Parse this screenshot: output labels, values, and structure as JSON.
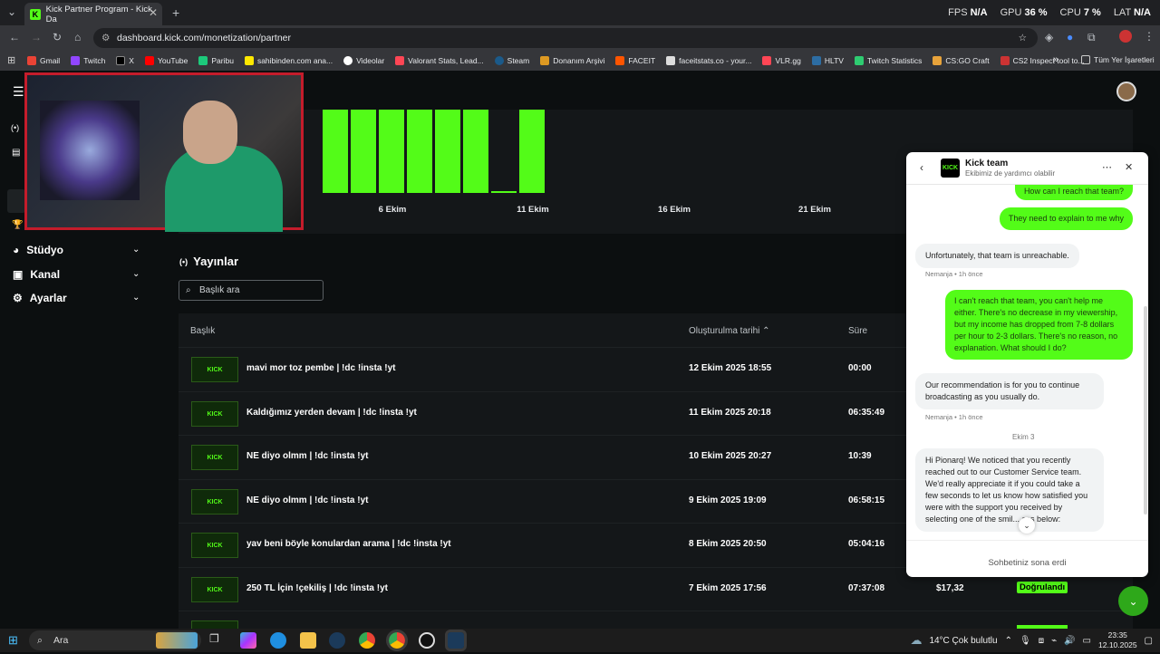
{
  "browser": {
    "tab_title": "Kick Partner Program - Kick Da",
    "tab_favicon": "K",
    "new_tab": "+",
    "url": "dashboard.kick.com/monetization/partner",
    "perf": [
      {
        "label": "FPS",
        "value": "N/A"
      },
      {
        "label": "GPU",
        "value": "36 %"
      },
      {
        "label": "CPU",
        "value": "7 %"
      },
      {
        "label": "LAT",
        "value": "N/A"
      }
    ],
    "bookmarks": [
      "Gmail",
      "Twitch",
      "X",
      "YouTube",
      "Paribu",
      "sahibinden.com ana...",
      "Videolar",
      "Valorant Stats, Lead...",
      "Steam",
      "Donanım Arşivi",
      "FACEIT",
      "faceitstats.co - your...",
      "VLR.gg",
      "HLTV",
      "Twitch Statistics",
      "CS:GO Craft",
      "CS2 Inspect tool to..."
    ],
    "bookmarks_more": "»",
    "all_bookmarks": "Tüm Yer İşaretleri"
  },
  "sidebar": {
    "items": [
      {
        "label": "Stüdyo"
      },
      {
        "label": "Kanal"
      },
      {
        "label": "Ayarlar"
      }
    ]
  },
  "chart_data": {
    "type": "bar",
    "tick_labels": [
      "6 Ekim",
      "11 Ekim",
      "16 Ekim",
      "21 Ekim"
    ],
    "bar_color": "#53fc18"
  },
  "streams": {
    "heading": "Yayınlar",
    "search_placeholder": "Başlık ara",
    "col_title": "Başlık",
    "col_created": "Oluşturulma tarihi",
    "col_duration": "Süre",
    "rows": [
      {
        "title": "mavi mor toz pembe | !dc !insta !yt",
        "date": "12 Ekim 2025 18:55",
        "duration": "00:00",
        "revenue": "",
        "status": ""
      },
      {
        "title": "Kaldığımız yerden devam | !dc !insta !yt",
        "date": "11 Ekim 2025 20:18",
        "duration": "06:35:49",
        "revenue": "",
        "status": ""
      },
      {
        "title": "NE diyo olmm | !dc !insta !yt",
        "date": "10 Ekim 2025 20:27",
        "duration": "10:39",
        "revenue": "",
        "status": ""
      },
      {
        "title": "NE diyo olmm | !dc !insta !yt",
        "date": "9 Ekim 2025 19:09",
        "duration": "06:58:15",
        "revenue": "",
        "status": ""
      },
      {
        "title": "yav beni böyle konulardan arama | !dc !insta !yt",
        "date": "8 Ekim 2025 20:50",
        "duration": "05:04:16",
        "revenue": "",
        "status": ""
      },
      {
        "title": "250 TL İçin !çekiliş | !dc !insta !yt",
        "date": "7 Ekim 2025 17:56",
        "duration": "07:37:08",
        "revenue": "$17,32",
        "status": "Doğrulandı"
      }
    ],
    "thumb_text": "KICK"
  },
  "chat": {
    "title": "Kick team",
    "subtitle": "Ekibimiz de yardımcı olabilir",
    "logo": "KICK",
    "messages": {
      "me1": "How can I reach that team?",
      "me2": "They need to explain to me why",
      "them1": "Unfortunately, that team is unreachable.",
      "them1_meta": "Nemanja • 1h önce",
      "me3": "I can't reach that team, you can't help me either. There's no decrease in my viewership, but my income has dropped from 7-8 dollars per hour to 2-3 dollars. There's no reason, no explanation. What should I do?",
      "them2": "Our recommendation is for you to continue broadcasting as you usually do.",
      "them2_meta": "Nemanja • 1h önce",
      "divider": "Ekim 3",
      "them3": "Hi Pionarq! We noticed that you recently reached out to our Customer Service team. We'd really appreciate it if you could take a few seconds to let us know how satisfied you were with the support you received by selecting one of the smil... ces below:"
    },
    "footer": "Sohbetiniz sona erdi"
  },
  "taskbar": {
    "search": "Ara",
    "weather": "14°C  Çok bulutlu",
    "time": "23:35",
    "date": "12.10.2025"
  }
}
